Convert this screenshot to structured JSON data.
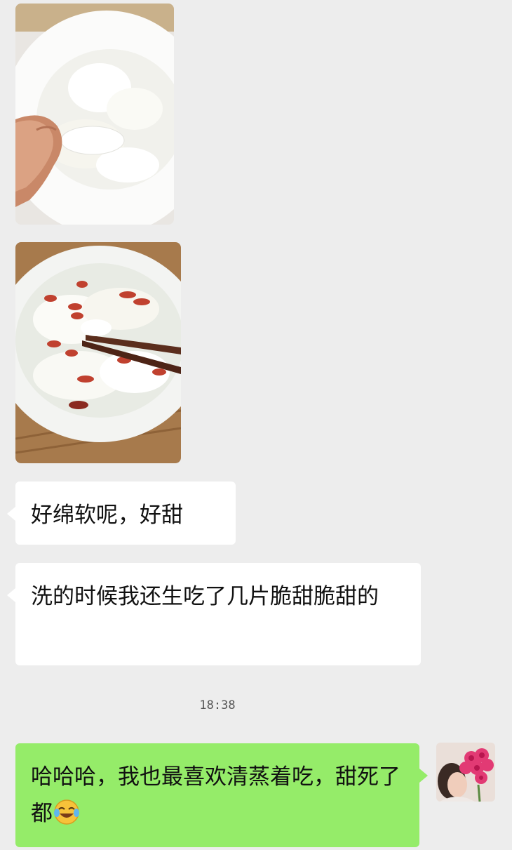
{
  "chat": {
    "messages": [
      {
        "sender": "other",
        "type": "image",
        "description_icon": "photo-icon"
      },
      {
        "sender": "other",
        "type": "image",
        "description_icon": "photo-icon"
      },
      {
        "sender": "other",
        "type": "text",
        "text": "好绵软呢，好甜"
      },
      {
        "sender": "other",
        "type": "text",
        "text": "洗的时候我还生吃了几片脆甜脆甜的"
      },
      {
        "sender": "self",
        "type": "text",
        "text": "哈哈哈，我也最喜欢清蒸着吃，甜死了都",
        "emoji": "laughing-crying-emoji"
      }
    ],
    "timestamp": "18:38"
  },
  "colors": {
    "background": "#ededed",
    "incoming_bubble": "#ffffff",
    "outgoing_bubble": "#95ec69"
  }
}
